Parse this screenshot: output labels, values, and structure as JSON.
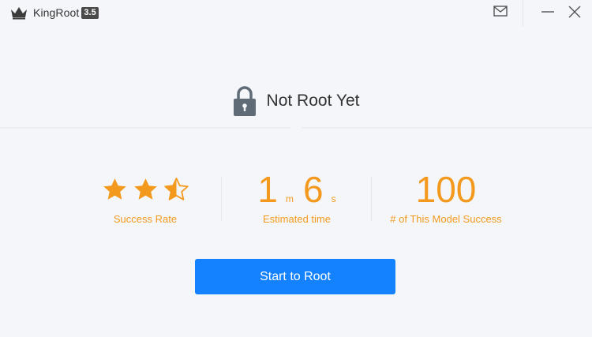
{
  "app": {
    "name": "KingRoot",
    "version": "3.5"
  },
  "titlebar": {
    "icons": [
      "crown-logo-icon",
      "mail-icon",
      "minimize-icon",
      "close-icon"
    ]
  },
  "status": {
    "text": "Not Root Yet",
    "icon": "lock-icon"
  },
  "stats": {
    "success_rate": {
      "label": "Success Rate",
      "stars_filled": 2.5,
      "stars_total": 3
    },
    "estimated_time": {
      "minutes": "1",
      "minutes_unit": "m",
      "seconds": "6",
      "seconds_unit": "s",
      "label": "Estimated time"
    },
    "model_success": {
      "value": "100",
      "label": "# of This Model Success"
    }
  },
  "actions": {
    "start_label": "Start to Root"
  },
  "colors": {
    "accent_orange": "#f39a1e",
    "button_blue": "#1482ff",
    "background": "#f4f6f9",
    "lock_gray": "#5f6b77"
  }
}
